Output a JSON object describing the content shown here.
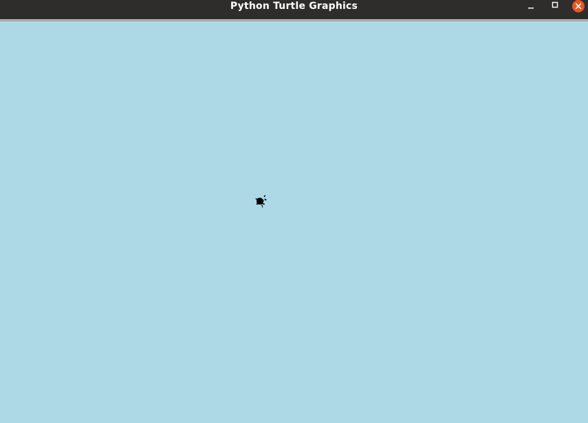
{
  "window": {
    "title": "Python Turtle Graphics",
    "controls": {
      "minimize_icon": "minimize-icon",
      "maximize_icon": "maximize-icon",
      "close_icon": "close-icon"
    }
  },
  "canvas": {
    "background_color": "#add8e6",
    "turtle": {
      "shape": "turtle",
      "color": "#000000",
      "icon": "turtle-icon"
    }
  },
  "colors": {
    "titlebar": "#2f2d2c",
    "close_button": "#e95420"
  }
}
